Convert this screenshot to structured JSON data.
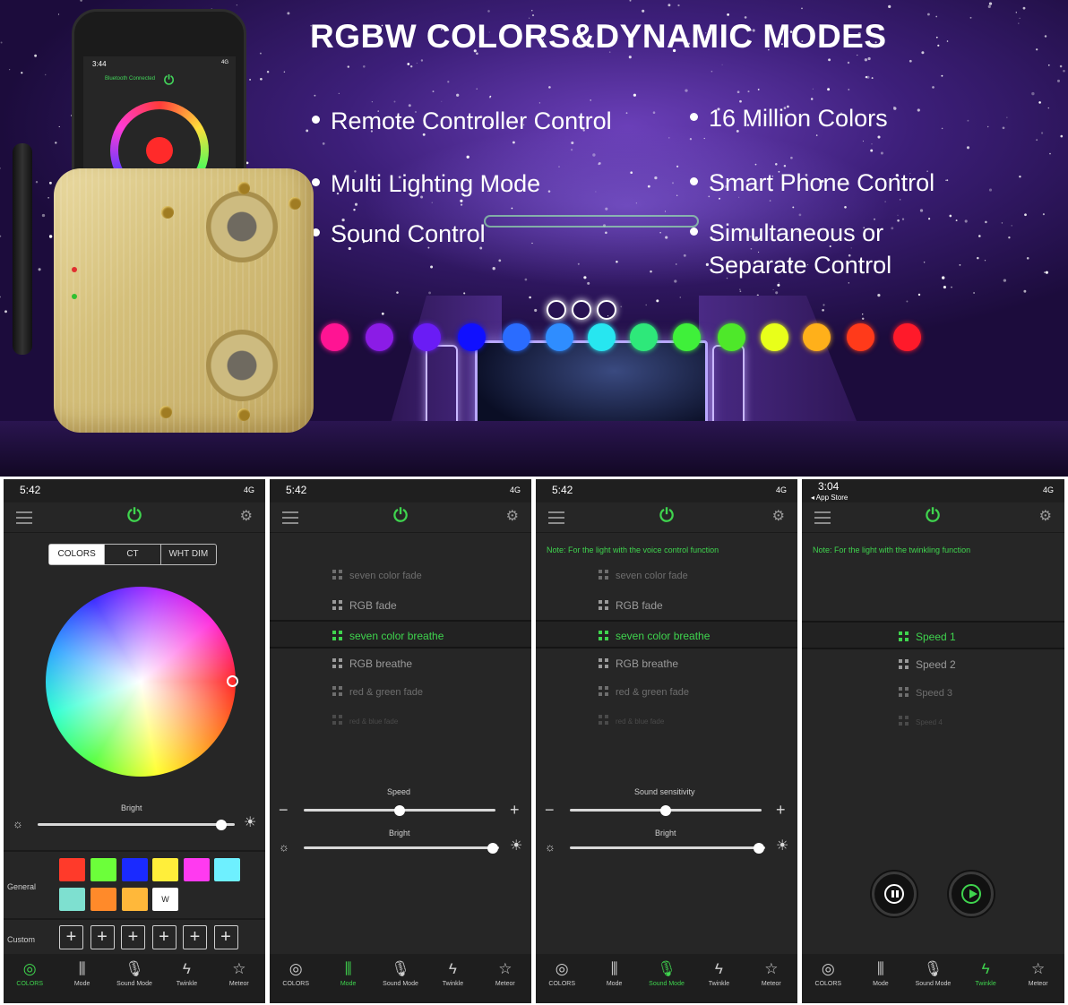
{
  "banner": {
    "title": "RGBW COLORS&DYNAMIC MODES",
    "features_left": [
      "Remote Controller Control",
      "Multi Lighting Mode",
      "Sound Control"
    ],
    "features_right": [
      "16 Million Colors",
      "Smart Phone Control",
      "Simultaneous or",
      "Separate Control"
    ],
    "swatch_colors": [
      "#ff1493",
      "#8b1ce6",
      "#6a1cf5",
      "#1010ff",
      "#2a6cff",
      "#2f8dff",
      "#27e6f0",
      "#2ee87a",
      "#3ff03a",
      "#4ee82a",
      "#e8ff1a",
      "#ffb01a",
      "#ff3a1a",
      "#ff1a2a"
    ],
    "phone": {
      "time": "3:44",
      "status": "4G",
      "bt": "Bluetooth Connected"
    }
  },
  "screens": [
    {
      "time": "5:42",
      "status": "4G",
      "tabs": [
        "COLORS",
        "CT",
        "WHT DIM"
      ],
      "bright_label": "Bright",
      "bright_value": 0.93,
      "general_label": "General",
      "custom_label": "Custom",
      "general_colors": [
        "#ff3a2a",
        "#6cff3a",
        "#1a2aff",
        "#ffee3a",
        "#ff3af0",
        "#6ef0ff",
        "#7ee0d0",
        "#ff8a2a",
        "#ffb83a"
      ],
      "white_chip": "W",
      "plus": "+",
      "active_tab": 0
    },
    {
      "time": "5:42",
      "status": "4G",
      "modes": [
        "seven color fade",
        "RGB fade",
        "seven color breathe",
        "RGB breathe",
        "red & green fade",
        "red & blue fade"
      ],
      "active_mode": 2,
      "speed_label": "Speed",
      "speed_value": 0.5,
      "bright_label": "Bright",
      "bright_value": 0.97,
      "active_tab": 1
    },
    {
      "time": "5:42",
      "status": "4G",
      "note": "Note: For the light with the voice control function",
      "modes": [
        "seven color fade",
        "RGB fade",
        "seven color breathe",
        "RGB breathe",
        "red & green fade",
        "red & blue fade"
      ],
      "active_mode": 2,
      "speed_label": "Sound sensitivity",
      "speed_value": 0.5,
      "bright_label": "Bright",
      "bright_value": 0.97,
      "active_tab": 2
    },
    {
      "time": "3:04",
      "time_sub": "◂ App Store",
      "status": "4G",
      "note": "Note: For the light with the twinkling function",
      "modes": [
        "Speed 1",
        "Speed 2",
        "Speed 3",
        "Speed 4"
      ],
      "active_mode": 0,
      "active_tab": 3
    }
  ],
  "tabbar": [
    "COLORS",
    "Mode",
    "Sound Mode",
    "Twinkle",
    "Meteor"
  ],
  "colors": {
    "accent": "#3fd44e",
    "screen_bg": "#262626"
  }
}
